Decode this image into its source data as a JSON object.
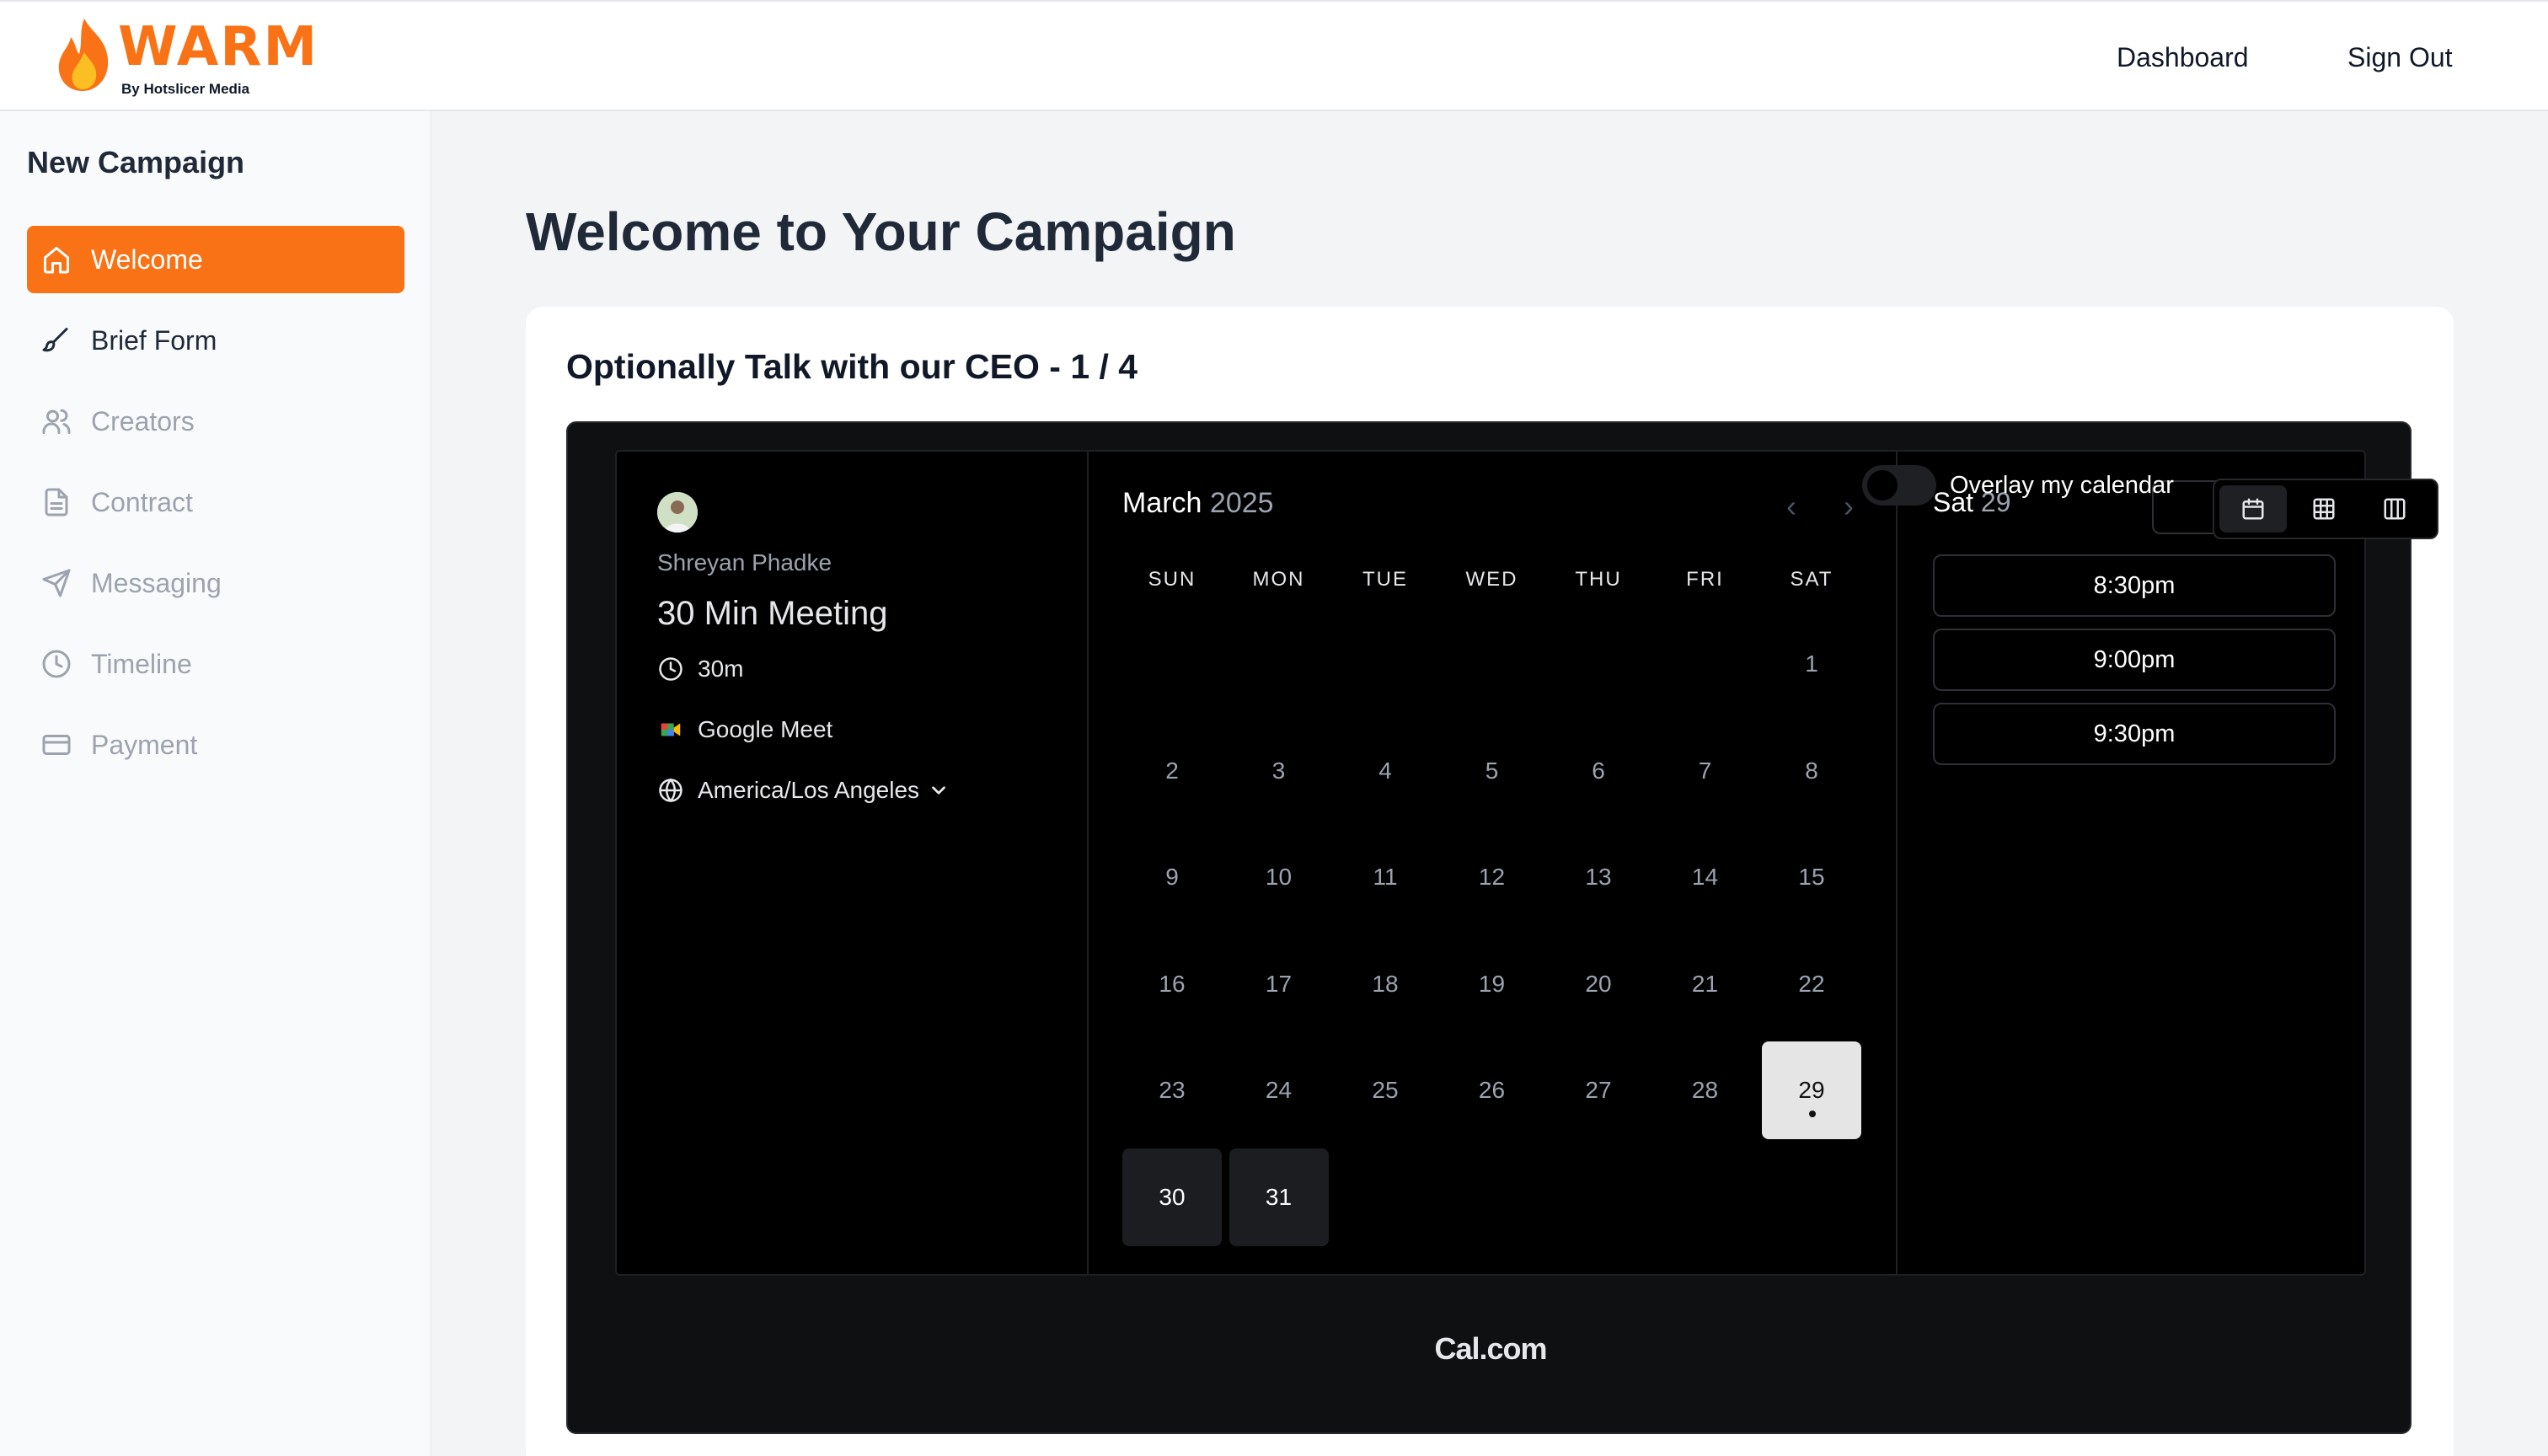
{
  "header": {
    "logo_text": "WARM",
    "logo_subtitle": "By Hotslicer Media",
    "nav": {
      "dashboard": "Dashboard",
      "sign_out": "Sign Out"
    }
  },
  "sidebar": {
    "title": "New Campaign",
    "items": [
      {
        "label": "Welcome",
        "icon": "home-icon",
        "state": "active"
      },
      {
        "label": "Brief Form",
        "icon": "brush-icon",
        "state": "enabled"
      },
      {
        "label": "Creators",
        "icon": "users-icon",
        "state": "disabled"
      },
      {
        "label": "Contract",
        "icon": "document-icon",
        "state": "disabled"
      },
      {
        "label": "Messaging",
        "icon": "send-icon",
        "state": "disabled"
      },
      {
        "label": "Timeline",
        "icon": "clock-icon",
        "state": "disabled"
      },
      {
        "label": "Payment",
        "icon": "credit-card-icon",
        "state": "disabled"
      }
    ]
  },
  "main": {
    "title": "Welcome to Your Campaign",
    "card_title": "Optionally Talk with our CEO - 1 / 4"
  },
  "booking": {
    "host_name": "Shreyan Phadke",
    "event_title": "30 Min Meeting",
    "duration": "30m",
    "location": "Google Meet",
    "timezone": "America/Los Angeles",
    "month": "March",
    "year": "2025",
    "overlay_label": "Overlay my calendar",
    "weekdays": [
      "SUN",
      "MON",
      "TUE",
      "WED",
      "THU",
      "FRI",
      "SAT"
    ],
    "first_weekday_index": 6,
    "days_in_month": 31,
    "available_days": [
      29,
      30,
      31
    ],
    "selected_day": 29,
    "selected_day_header": {
      "weekday": "Sat",
      "day": "29"
    },
    "time_slots": [
      "8:30pm",
      "9:00pm",
      "9:30pm"
    ],
    "powered_by": "Cal.com"
  },
  "colors": {
    "accent": "#f97316",
    "embed_bg": "#0f1012",
    "booker_bg": "#000000",
    "page_bg": "#f3f4f6"
  }
}
